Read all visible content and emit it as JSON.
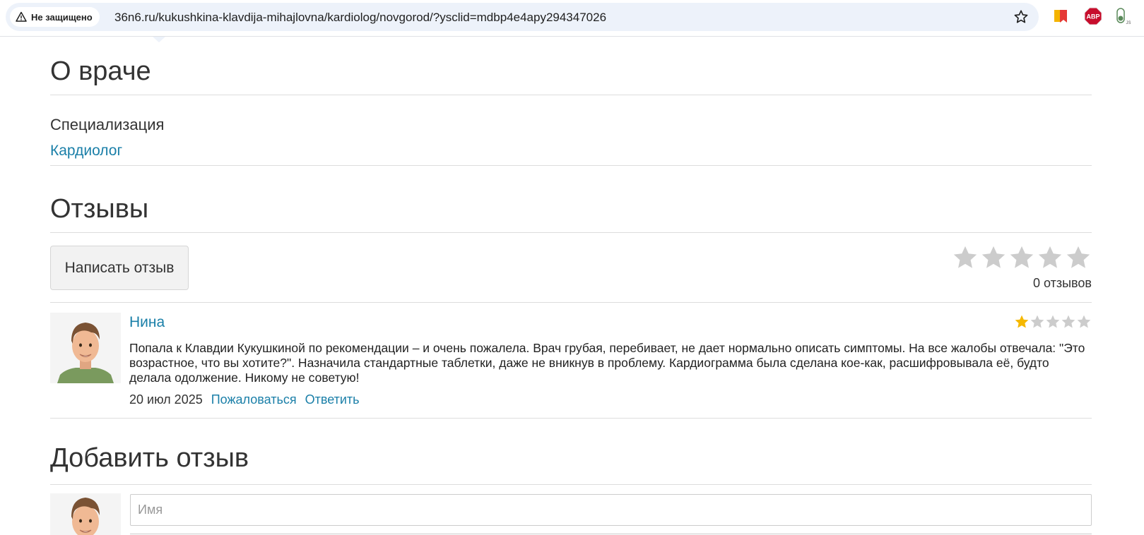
{
  "browser": {
    "security_label": "Не защищено",
    "url": "36n6.ru/kukushkina-klavdija-mihajlovna/kardiolog/novgorod/?ysclid=mdbp4e4apy294347026",
    "extensions": [
      "bookmark-icon",
      "adblock-icon",
      "js-toggle-icon"
    ],
    "abp_label": "ABP",
    "js_label": "JS"
  },
  "about": {
    "title": "О враче",
    "specialization_label": "Специализация",
    "specialization_value": "Кардиолог"
  },
  "reviews": {
    "title": "Отзывы",
    "write_button": "Написать отзыв",
    "overall_rating": 0,
    "count_text": "0 отзывов",
    "items": [
      {
        "author": "Нина",
        "rating": 1,
        "text": "Попала к Клавдии Кукушкиной по рекомендации – и очень пожалела. Врач грубая, перебивает, не дает нормально описать симптомы. На все жалобы отвечала: \"Это возрастное, что вы хотите?\". Назначила стандартные таблетки, даже не вникнув в проблему. Кардиограмма была сделана кое-как, расшифровывала её, будто делала одолжение. Никому не советую!",
        "date": "20 июл 2025",
        "complain_label": "Пожаловаться",
        "reply_label": "Ответить"
      }
    ]
  },
  "add_review": {
    "title": "Добавить отзыв",
    "name_placeholder": "Имя"
  },
  "colors": {
    "link": "#1a7fa8",
    "star_empty": "#cccccc",
    "star_filled": "#f5b800"
  }
}
